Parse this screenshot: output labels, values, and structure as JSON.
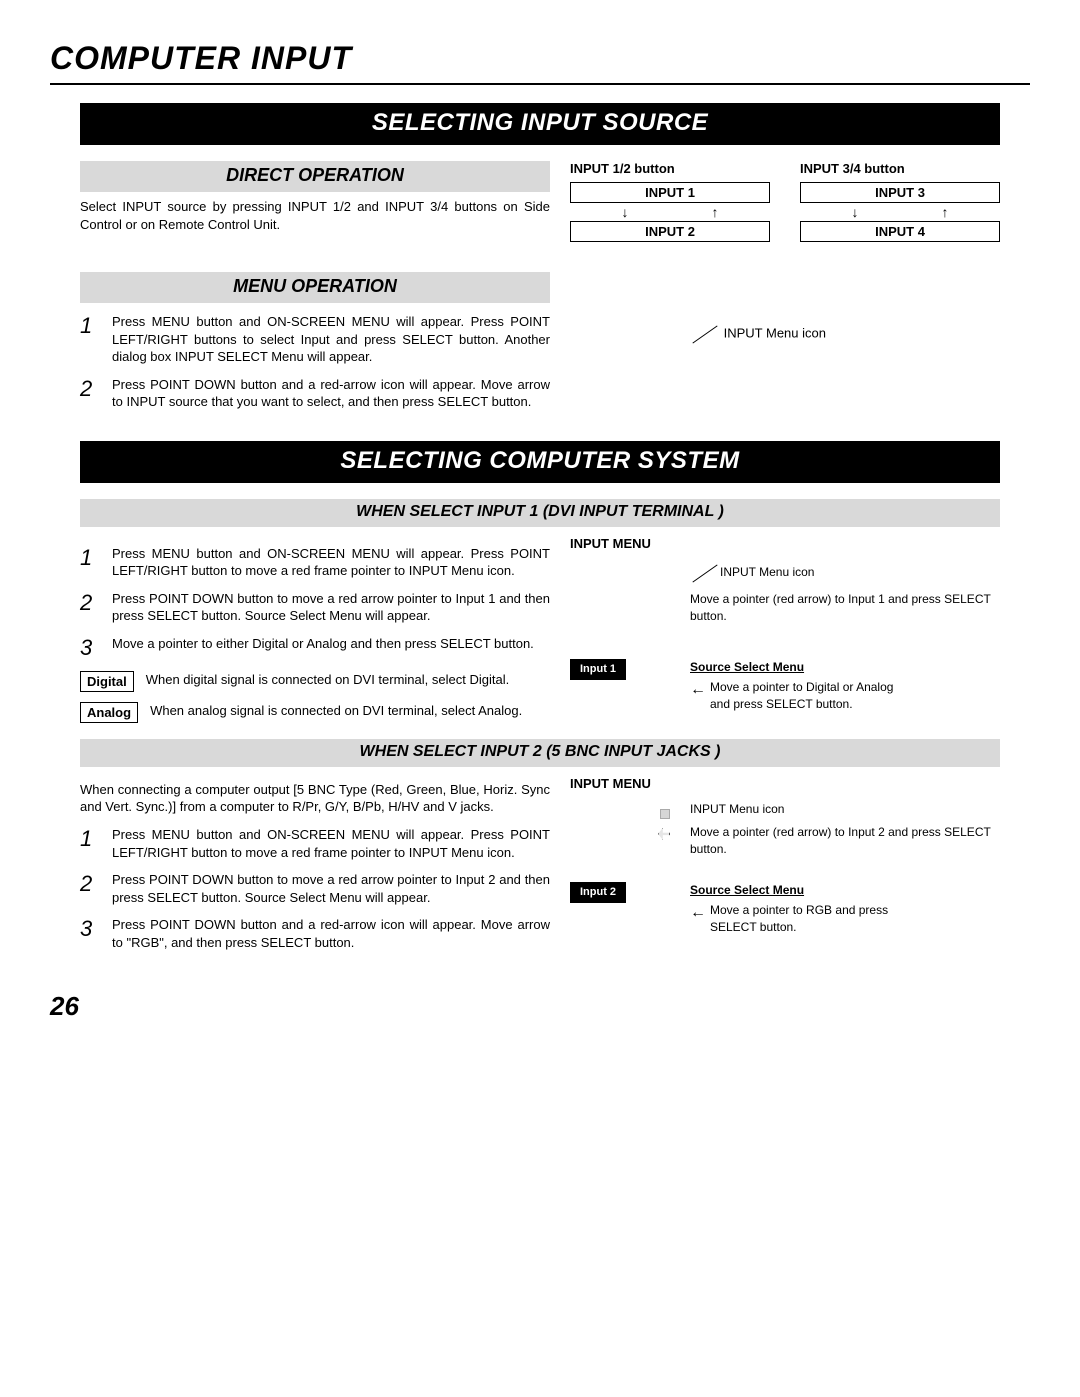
{
  "page_title": "COMPUTER INPUT",
  "page_number": "26",
  "section_selecting_input_source": {
    "bar": "SELECTING INPUT SOURCE",
    "direct_operation": {
      "header": "DIRECT OPERATION",
      "text": "Select INPUT source by pressing INPUT 1/2 and INPUT 3/4 buttons on Side Control or on Remote Control Unit.",
      "btn12_header": "INPUT 1/2 button",
      "btn34_header": "INPUT 3/4 button",
      "input1": "INPUT 1",
      "input2": "INPUT 2",
      "input3": "INPUT 3",
      "input4": "INPUT 4"
    },
    "menu_operation": {
      "header": "MENU OPERATION",
      "step1": "Press MENU button and ON-SCREEN MENU will appear.  Press POINT LEFT/RIGHT buttons to select Input and press  SELECT button.  Another dialog box INPUT SELECT Menu will appear.",
      "step2": "Press POINT DOWN button and a red-arrow icon will appear. Move arrow to INPUT source that you want to select, and then press SELECT button.",
      "icon_label": "INPUT Menu icon"
    }
  },
  "section_selecting_computer_system": {
    "bar": "SELECTING COMPUTER SYSTEM",
    "when_input1": {
      "header": "WHEN SELECT  INPUT 1 (DVI INPUT TERMINAL )",
      "step1": "Press MENU button and ON-SCREEN MENU will appear.  Press POINT LEFT/RIGHT button to move a red frame pointer to INPUT Menu icon.",
      "step2": "Press POINT DOWN button to move a red arrow pointer to Input 1 and then press SELECT button.  Source Select Menu will appear.",
      "step3": "Move a pointer to either Digital or Analog and then press SELECT button.",
      "digital_label": "Digital",
      "digital_text": "When digital signal is connected on DVI terminal, select Digital.",
      "analog_label": "Analog",
      "analog_text": "When analog signal is connected on DVI terminal, select Analog.",
      "diagram": {
        "title": "INPUT MENU",
        "icon_label": "INPUT Menu icon",
        "move_text": "Move a pointer (red arrow) to Input 1 and press SELECT button.",
        "chip": "Input 1",
        "ssm_title": "Source Select Menu",
        "ssm_text": "Move a pointer to Digital or Analog and press SELECT button."
      }
    },
    "when_input2": {
      "header": "WHEN SELECT INPUT 2 (5 BNC INPUT JACKS )",
      "intro": "When connecting a computer output [5 BNC Type (Red, Green, Blue, Horiz. Sync and Vert. Sync.)] from a computer to R/Pr, G/Y, B/Pb, H/HV and V jacks.",
      "step1": "Press MENU button and ON-SCREEN MENU will appear.  Press POINT LEFT/RIGHT button to move a red frame pointer to INPUT Menu icon.",
      "step2": "Press POINT DOWN button to move a red arrow pointer to Input 2 and then press SELECT button.  Source Select Menu will appear.",
      "step3": "Press POINT DOWN button and a red-arrow icon will appear. Move arrow to \"RGB\", and then press SELECT button.",
      "diagram": {
        "title": "INPUT MENU",
        "icon_label": "INPUT Menu icon",
        "move_text": "Move a pointer (red arrow) to Input 2 and press SELECT button.",
        "chip": "Input 2",
        "ssm_title": "Source Select Menu",
        "ssm_text": "Move a pointer to RGB and press SELECT button."
      }
    }
  }
}
